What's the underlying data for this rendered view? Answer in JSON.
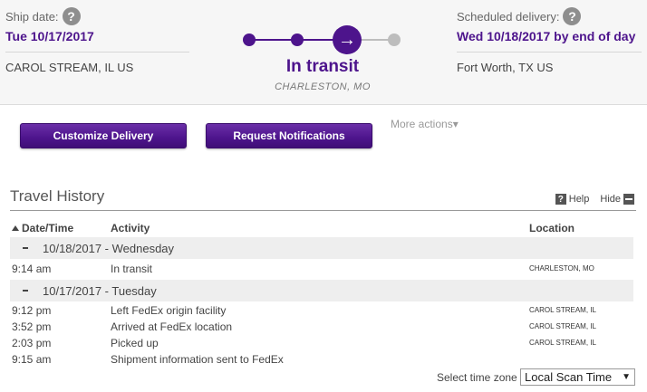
{
  "summary": {
    "ship_label": "Ship date:",
    "ship_date": "Tue 10/17/2017",
    "origin": "CAROL STREAM, IL US",
    "sched_label": "Scheduled delivery:",
    "sched_date": "Wed 10/18/2017 by end of day",
    "destination": "Fort Worth, TX US",
    "status": "In transit",
    "status_location": "CHARLESTON, MO",
    "help_glyph": "?",
    "arrow_glyph": "→"
  },
  "actions": {
    "customize": "Customize Delivery",
    "notify": "Request Notifications",
    "more": "More actions▾"
  },
  "history": {
    "title": "Travel History",
    "help": "Help",
    "hide": "Hide",
    "col_date": "Date/Time",
    "col_activity": "Activity",
    "col_location": "Location",
    "days": [
      {
        "label": "10/18/2017 - Wednesday",
        "events": [
          {
            "time": "9:14 am",
            "activity": "In transit",
            "location": "CHARLESTON, MO"
          }
        ]
      },
      {
        "label": "10/17/2017 - Tuesday",
        "events": [
          {
            "time": "9:12 pm",
            "activity": "Left FedEx origin facility",
            "location": "CAROL STREAM, IL"
          },
          {
            "time": "3:52 pm",
            "activity": "Arrived at FedEx location",
            "location": "CAROL STREAM, IL"
          },
          {
            "time": "2:03 pm",
            "activity": "Picked up",
            "location": "CAROL STREAM, IL"
          },
          {
            "time": "9:15 am",
            "activity": "Shipment information sent to FedEx",
            "location": ""
          }
        ]
      }
    ],
    "tz_label": "Select time zone",
    "tz_value": "Local Scan Time",
    "tz_arrow": "▼"
  },
  "colors": {
    "accent": "#4d148c",
    "inactive": "#bdbdbd"
  },
  "icons": [
    "help-icon",
    "arrow-right-icon",
    "sort-up-icon",
    "minus-icon",
    "dropdown-arrow-icon"
  ]
}
